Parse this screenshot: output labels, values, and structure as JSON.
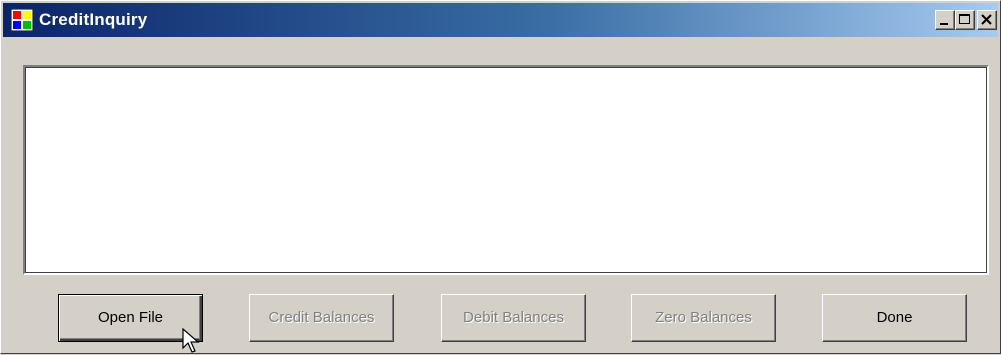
{
  "window": {
    "title": "CreditInquiry",
    "icons": {
      "app": "application-icon",
      "minimize": "minimize-icon",
      "maximize": "maximize-icon",
      "close": "close-icon"
    },
    "colors": {
      "titlebar_start": "#0a246a",
      "titlebar_end": "#a6caf0",
      "face": "#d4d0c8"
    }
  },
  "output": {
    "value": ""
  },
  "buttons": {
    "open_file": "Open File",
    "credit_balances": "Credit Balances",
    "debit_balances": "Debit Balances",
    "zero_balances": "Zero Balances",
    "done": "Done"
  },
  "pointer": "mouse-pointer-icon"
}
